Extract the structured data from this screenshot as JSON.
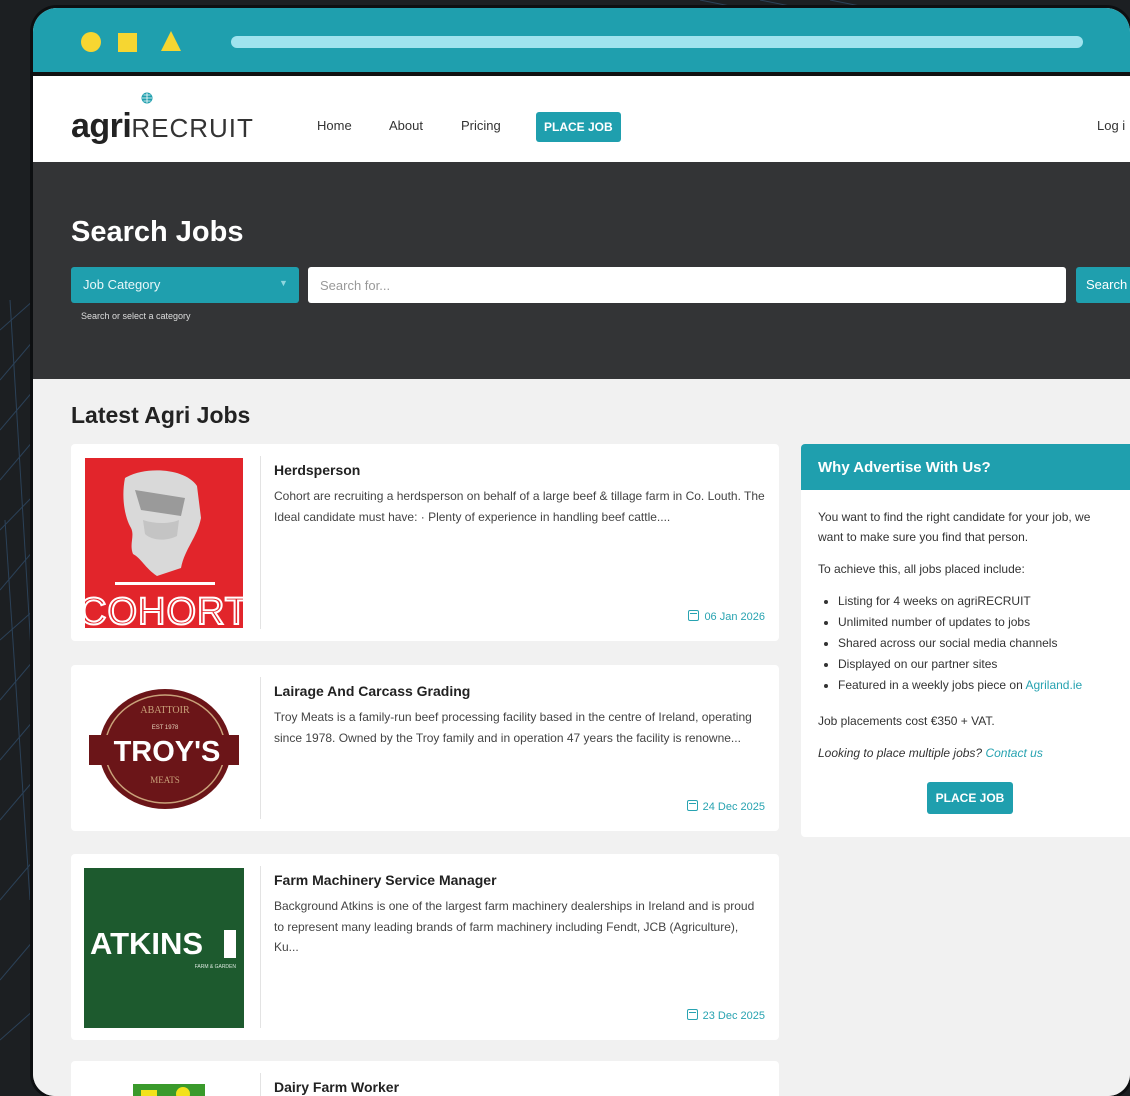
{
  "theme": {
    "accent": "#1f9fae",
    "dark": "#333436",
    "frame_bg": "#1c1f22",
    "shapes": "#f6d631"
  },
  "window": {
    "controls": [
      "circle-icon",
      "square-icon",
      "triangle-icon"
    ]
  },
  "brand": {
    "bold": "agri",
    "light": "RECRUIT"
  },
  "nav": {
    "home": "Home",
    "about": "About",
    "pricing": "Pricing",
    "place_job": "PLACE JOB",
    "login": "Log i"
  },
  "hero": {
    "title": "Search Jobs",
    "category": "Job Category",
    "search_placeholder": "Search for...",
    "search_button": "Search",
    "hint": "Search or select a category"
  },
  "main": {
    "title": "Latest Agri Jobs"
  },
  "jobs": [
    {
      "logo": "cohort-logo",
      "logo_text": "COHORT",
      "title": "Herdsperson",
      "description": "Cohort are recruiting a herdsperson on behalf of a large beef & tillage farm in Co. Louth. The Ideal candidate must have: · Plenty of experience in handling beef cattle....",
      "date": "06 Jan 2026"
    },
    {
      "logo": "troys-logo",
      "logo_text": "TROY'S",
      "logo_top": "ABATTOIR",
      "logo_est": "EST 1978",
      "logo_meats": "MEATS",
      "title": "Lairage And Carcass Grading",
      "description": "Troy Meats is a family-run beef processing facility based in the centre of Ireland, operating since 1978. Owned by the Troy family and in operation 47 years the facility is renowne...",
      "date": "24 Dec 2025"
    },
    {
      "logo": "atkins-logo",
      "logo_text": "ATKINS",
      "logo_sub": "FARM & GARDEN",
      "title": "Farm Machinery Service Manager",
      "description": "Background Atkins is one of the largest farm machinery dealerships in Ireland and is proud to represent many leading brands of farm machinery including Fendt, JCB (Agriculture), Ku...",
      "date": "23 Dec 2025"
    },
    {
      "logo": "farm-logo",
      "title": "Dairy Farm Worker",
      "description": "",
      "date": ""
    }
  ],
  "sidebar": {
    "title": "Why Advertise With Us?",
    "intro": "You want to find the right candidate for your job, we want to make sure you find that person.",
    "lead": "To achieve this, all jobs placed include:",
    "items": [
      "Listing for 4 weeks on agriRECRUIT",
      "Unlimited number of updates to jobs",
      "Shared across our social media channels",
      "Displayed on our partner sites",
      "Featured in a weekly jobs piece on"
    ],
    "agriland": "Agriland.ie",
    "cost": "Job placements cost €350 + VAT.",
    "multiple": "Looking to place multiple jobs?",
    "contact": "Contact us",
    "button": "PLACE JOB"
  }
}
